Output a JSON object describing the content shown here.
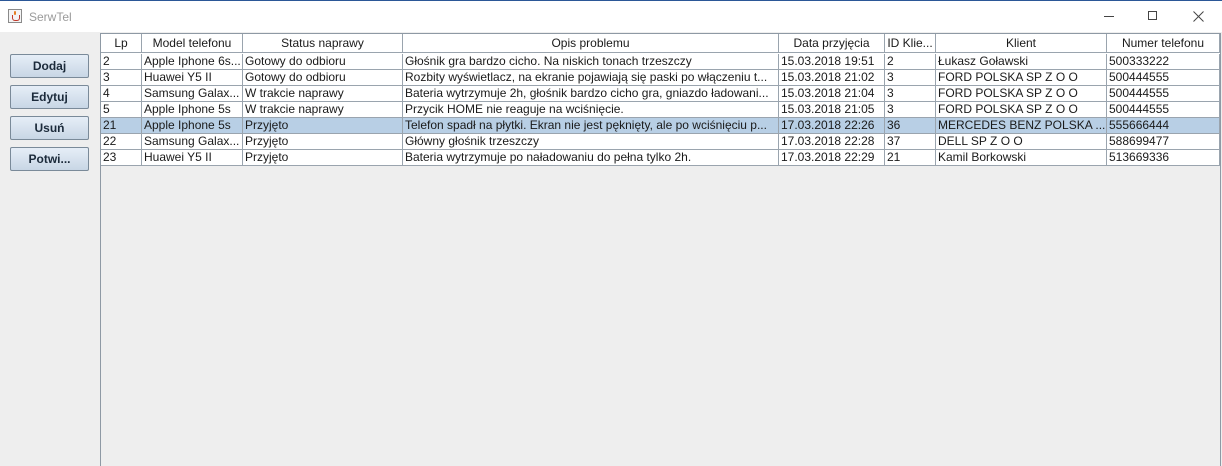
{
  "window": {
    "title": "SerwTel"
  },
  "buttons": {
    "add": "Dodaj",
    "edit": "Edytuj",
    "delete": "Usuń",
    "confirm": "Potwi..."
  },
  "table": {
    "columns": [
      "Lp",
      "Model telefonu",
      "Status naprawy",
      "Opis problemu",
      "Data przyjęcia",
      "ID Klie...",
      "Klient",
      "Numer telefonu"
    ],
    "selected_row": 4,
    "rows": [
      [
        "2",
        "Apple Iphone 6s...",
        "Gotowy do odbioru",
        "Głośnik gra bardzo cicho. Na niskich tonach trzeszczy",
        "15.03.2018 19:51",
        "2",
        "Łukasz Goławski",
        "500333222"
      ],
      [
        "3",
        "Huawei Y5 II",
        "Gotowy do odbioru",
        "Rozbity wyświetlacz, na ekranie pojawiają się paski po włączeniu t...",
        "15.03.2018 21:02",
        "3",
        "FORD POLSKA SP Z O O",
        "500444555"
      ],
      [
        "4",
        "Samsung Galax...",
        "W trakcie naprawy",
        "Bateria wytrzymuje 2h, głośnik bardzo cicho gra, gniazdo ładowani...",
        "15.03.2018 21:04",
        "3",
        "FORD POLSKA SP Z O O",
        "500444555"
      ],
      [
        "5",
        "Apple Iphone 5s",
        "W trakcie naprawy",
        "Przycik HOME nie reaguje na wciśnięcie.",
        "15.03.2018 21:05",
        "3",
        "FORD POLSKA SP Z O O",
        "500444555"
      ],
      [
        "21",
        "Apple Iphone 5s",
        "Przyjęto",
        "Telefon spadł na płytki. Ekran nie jest pęknięty, ale po wciśnięciu p...",
        "17.03.2018 22:26",
        "36",
        "MERCEDES BENZ POLSKA ...",
        "555666444"
      ],
      [
        "22",
        "Samsung Galax...",
        "Przyjęto",
        "Główny głośnik trzeszczy",
        "17.03.2018 22:28",
        "37",
        "DELL SP Z O O",
        "588699477"
      ],
      [
        "23",
        "Huawei Y5 II",
        "Przyjęto",
        "Bateria wytrzymuje po naładowaniu do pełna tylko 2h.",
        "17.03.2018 22:29",
        "21",
        "Kamil Borkowski",
        "513669336"
      ]
    ]
  }
}
